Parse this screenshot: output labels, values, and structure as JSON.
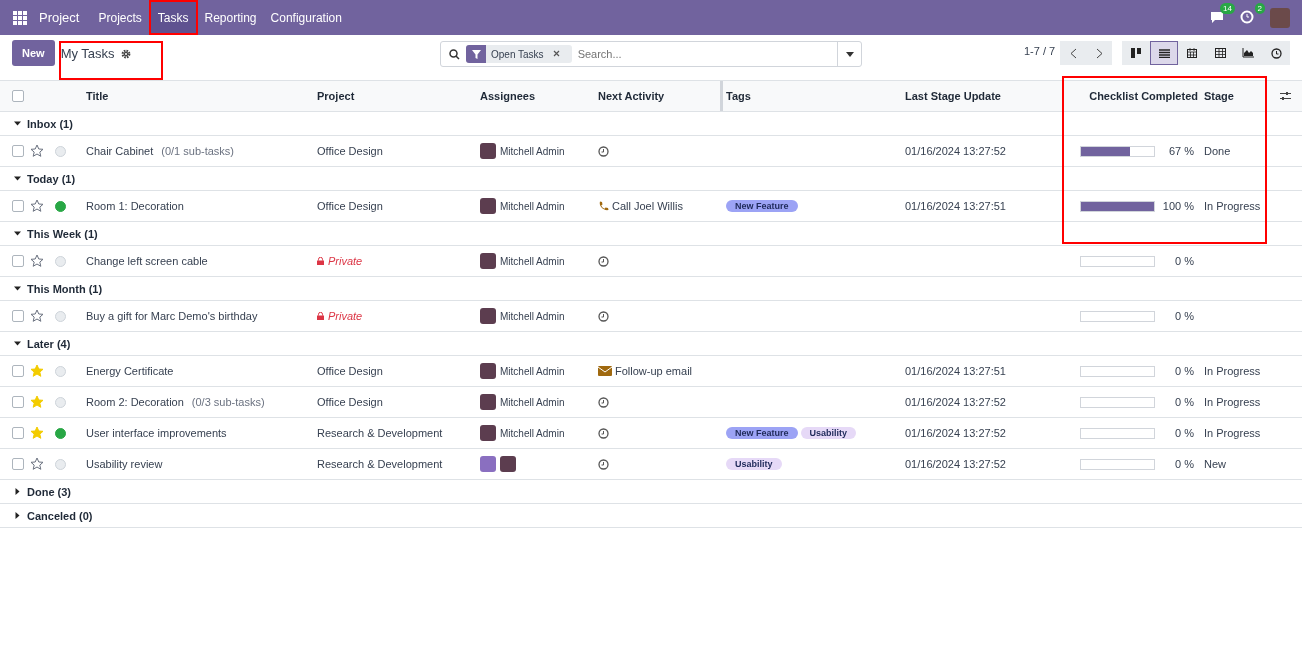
{
  "navbar": {
    "app_name": "Project",
    "menu": [
      {
        "label": "Projects",
        "selected": false
      },
      {
        "label": "Tasks",
        "selected": true
      },
      {
        "label": "Reporting",
        "selected": false
      },
      {
        "label": "Configuration",
        "selected": false
      }
    ],
    "messages_badge": "14",
    "activities_badge": "2"
  },
  "control_panel": {
    "new_button": "New",
    "title": "My Tasks",
    "search": {
      "facet": "Open Tasks",
      "placeholder": "Search..."
    },
    "pager": "1-7 / 7",
    "views": [
      {
        "kind": "kanban",
        "selected": false
      },
      {
        "kind": "list",
        "selected": true
      },
      {
        "kind": "calendar",
        "selected": false
      },
      {
        "kind": "pivot",
        "selected": false
      },
      {
        "kind": "graph",
        "selected": false
      },
      {
        "kind": "activity",
        "selected": false
      }
    ]
  },
  "table": {
    "select_all_checked": false,
    "columns": [
      "Title",
      "Project",
      "Assignees",
      "Next Activity",
      "Tags",
      "Last Stage Update",
      "Checklist Completed",
      "Stage"
    ],
    "groups": [
      {
        "label": "Inbox (1)",
        "expanded": true,
        "rows": [
          {
            "checked": false,
            "starred": false,
            "done": false,
            "title": "Chair Cabinet",
            "subtasks": "(0/1 sub-tasks)",
            "project": "Office Design",
            "private": false,
            "assignees": [
              {
                "kind": "named",
                "name": "Mitchell Admin"
              }
            ],
            "activity": {
              "kind": "clock"
            },
            "tags": [],
            "last_update": "01/16/2024 13:27:52",
            "checklist": {
              "level": 0.67,
              "reading": "67 %"
            },
            "stage": "Done"
          }
        ]
      },
      {
        "label": "Today (1)",
        "expanded": true,
        "rows": [
          {
            "checked": false,
            "starred": false,
            "done": true,
            "title": "Room 1: Decoration",
            "project": "Office Design",
            "private": false,
            "assignees": [
              {
                "kind": "named",
                "name": "Mitchell Admin"
              }
            ],
            "activity": {
              "kind": "phone",
              "label": "Call Joel Willis"
            },
            "tags": [
              {
                "label": "New Feature",
                "color": "#9ca3f5"
              }
            ],
            "last_update": "01/16/2024 13:27:51",
            "checklist": {
              "level": 1,
              "reading": "100 %"
            },
            "stage": "In Progress"
          }
        ]
      },
      {
        "label": "This Week (1)",
        "expanded": true,
        "rows": [
          {
            "checked": false,
            "starred": false,
            "done": false,
            "title": "Change left screen cable",
            "project": "Private",
            "private": true,
            "assignees": [
              {
                "kind": "named",
                "name": "Mitchell Admin"
              }
            ],
            "activity": {
              "kind": "clock"
            },
            "tags": [],
            "checklist": {
              "level": 0,
              "reading": "0 %"
            }
          }
        ]
      },
      {
        "label": "This Month (1)",
        "expanded": true,
        "rows": [
          {
            "checked": false,
            "starred": false,
            "done": false,
            "title": "Buy a gift for Marc Demo's birthday",
            "project": "Private",
            "private": true,
            "assignees": [
              {
                "kind": "named",
                "name": "Mitchell Admin"
              }
            ],
            "activity": {
              "kind": "clock"
            },
            "tags": [],
            "checklist": {
              "level": 0,
              "reading": "0 %"
            }
          }
        ]
      },
      {
        "label": "Later (4)",
        "expanded": true,
        "rows": [
          {
            "checked": false,
            "starred": true,
            "done": false,
            "title": "Energy Certificate",
            "project": "Office Design",
            "private": false,
            "assignees": [
              {
                "kind": "named",
                "name": "Mitchell Admin"
              }
            ],
            "activity": {
              "kind": "email",
              "label": "Follow-up email"
            },
            "tags": [],
            "last_update": "01/16/2024 13:27:51",
            "checklist": {
              "level": 0,
              "reading": "0 %"
            },
            "stage": "In Progress"
          },
          {
            "checked": false,
            "starred": true,
            "done": false,
            "title": "Room 2: Decoration",
            "subtasks": "(0/3 sub-tasks)",
            "project": "Office Design",
            "private": false,
            "assignees": [
              {
                "kind": "named",
                "name": "Mitchell Admin"
              }
            ],
            "activity": {
              "kind": "clock"
            },
            "tags": [],
            "last_update": "01/16/2024 13:27:52",
            "checklist": {
              "level": 0,
              "reading": "0 %"
            },
            "stage": "In Progress"
          },
          {
            "checked": false,
            "starred": true,
            "done": true,
            "title": "User interface improvements",
            "project": "Research & Development",
            "private": false,
            "assignees": [
              {
                "kind": "named",
                "name": "Mitchell Admin"
              }
            ],
            "activity": {
              "kind": "clock"
            },
            "tags": [
              {
                "label": "New Feature",
                "color": "#9ca3f5"
              },
              {
                "label": "Usability",
                "color": "#e6d9f7"
              }
            ],
            "last_update": "01/16/2024 13:27:52",
            "checklist": {
              "level": 0,
              "reading": "0 %"
            },
            "stage": "In Progress"
          },
          {
            "checked": false,
            "starred": false,
            "done": false,
            "title": "Usability review",
            "project": "Research & Development",
            "private": false,
            "assignees": [
              {
                "kind": "avatar"
              },
              {
                "kind": "avatar"
              }
            ],
            "activity": {
              "kind": "clock"
            },
            "tags": [
              {
                "label": "Usability",
                "color": "#e6d9f7"
              }
            ],
            "last_update": "01/16/2024 13:27:52",
            "checklist": {
              "level": 0,
              "reading": "0 %"
            },
            "stage": "New"
          }
        ]
      },
      {
        "label": "Done (3)",
        "expanded": false
      },
      {
        "label": "Canceled (0)",
        "expanded": false
      }
    ]
  }
}
